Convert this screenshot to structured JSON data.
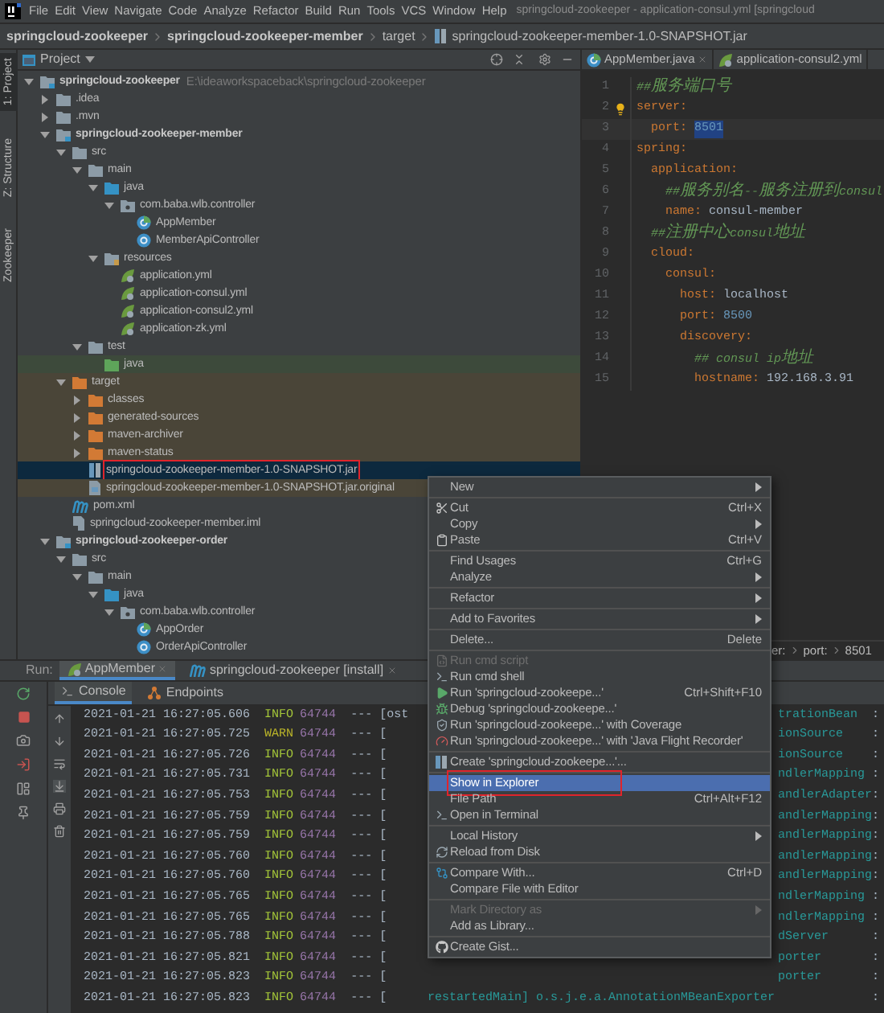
{
  "menu_bar": {
    "items": [
      "File",
      "Edit",
      "View",
      "Navigate",
      "Code",
      "Analyze",
      "Refactor",
      "Build",
      "Run",
      "Tools",
      "VCS",
      "Window",
      "Help"
    ],
    "title": "springcloud-zookeeper - application-consul.yml [springcloud"
  },
  "breadcrumbs": [
    "springcloud-zookeeper",
    "springcloud-zookeeper-member",
    "target",
    "springcloud-zookeeper-member-1.0-SNAPSHOT.jar"
  ],
  "tool_strip": [
    {
      "label": "1: Project",
      "selected": true
    },
    {
      "label": "Z: Structure",
      "selected": false
    },
    {
      "label": "Zookeeper",
      "selected": false
    }
  ],
  "project": {
    "title": "Project",
    "tree": [
      {
        "label": "springcloud-zookeeper",
        "kind": "module",
        "path": "E:\\ideaworkspaceback\\springcloud-zookeeper",
        "expanded": true,
        "selected": false,
        "children": [
          {
            "label": ".idea",
            "kind": "folder",
            "expanded": false,
            "selected": false
          },
          {
            "label": ".mvn",
            "kind": "folder",
            "expanded": false,
            "selected": false
          },
          {
            "label": "springcloud-zookeeper-member",
            "kind": "module",
            "expanded": true,
            "selected": false,
            "children": [
              {
                "label": "src",
                "kind": "folder",
                "expanded": true,
                "selected": false,
                "children": [
                  {
                    "label": "main",
                    "kind": "folder",
                    "expanded": true,
                    "selected": false,
                    "children": [
                      {
                        "label": "java",
                        "kind": "source-folder",
                        "expanded": true,
                        "selected": false,
                        "children": [
                          {
                            "label": "com.baba.wlb.controller",
                            "kind": "package",
                            "expanded": true,
                            "selected": false,
                            "children": [
                              {
                                "label": "AppMember",
                                "kind": "spring-class",
                                "selected": false
                              },
                              {
                                "label": "MemberApiController",
                                "kind": "class",
                                "selected": false
                              }
                            ]
                          }
                        ]
                      },
                      {
                        "label": "resources",
                        "kind": "resources-folder",
                        "expanded": true,
                        "selected": false,
                        "children": [
                          {
                            "label": "application.yml",
                            "kind": "yml",
                            "selected": false
                          },
                          {
                            "label": "application-consul.yml",
                            "kind": "yml",
                            "selected": false
                          },
                          {
                            "label": "application-consul2.yml",
                            "kind": "yml",
                            "selected": false
                          },
                          {
                            "label": "application-zk.yml",
                            "kind": "yml",
                            "selected": false
                          }
                        ]
                      }
                    ]
                  },
                  {
                    "label": "test",
                    "kind": "folder",
                    "expanded": true,
                    "selected": false,
                    "children": [
                      {
                        "label": "java",
                        "kind": "test-folder",
                        "selected": false
                      }
                    ]
                  }
                ]
              },
              {
                "label": "target",
                "kind": "excluded-folder",
                "expanded": true,
                "excluded": true,
                "selected": false,
                "children": [
                  {
                    "label": "classes",
                    "kind": "excluded-folder",
                    "expanded": false,
                    "excluded": true,
                    "selected": false
                  },
                  {
                    "label": "generated-sources",
                    "kind": "excluded-folder",
                    "expanded": false,
                    "excluded": true,
                    "selected": false
                  },
                  {
                    "label": "maven-archiver",
                    "kind": "excluded-folder",
                    "expanded": false,
                    "excluded": true,
                    "selected": false
                  },
                  {
                    "label": "maven-status",
                    "kind": "excluded-folder",
                    "expanded": false,
                    "excluded": true,
                    "selected": false
                  },
                  {
                    "label": "springcloud-zookeeper-member-1.0-SNAPSHOT.jar",
                    "kind": "jar",
                    "selected": true,
                    "outlined": true
                  },
                  {
                    "label": "springcloud-zookeeper-member-1.0-SNAPSHOT.jar.original",
                    "kind": "archive-file",
                    "excluded": true,
                    "selected": false
                  }
                ]
              },
              {
                "label": "pom.xml",
                "kind": "maven",
                "selected": false
              },
              {
                "label": "springcloud-zookeeper-member.iml",
                "kind": "iml",
                "selected": false
              }
            ]
          },
          {
            "label": "springcloud-zookeeper-order",
            "kind": "module",
            "expanded": true,
            "selected": false,
            "children": [
              {
                "label": "src",
                "kind": "folder",
                "expanded": true,
                "selected": false,
                "children": [
                  {
                    "label": "main",
                    "kind": "folder",
                    "expanded": true,
                    "selected": false,
                    "children": [
                      {
                        "label": "java",
                        "kind": "source-folder",
                        "expanded": true,
                        "selected": false,
                        "children": [
                          {
                            "label": "com.baba.wlb.controller",
                            "kind": "package",
                            "expanded": true,
                            "selected": false,
                            "children": [
                              {
                                "label": "AppOrder",
                                "kind": "spring-class",
                                "selected": false
                              },
                              {
                                "label": "OrderApiController",
                                "kind": "class",
                                "selected": false
                              }
                            ]
                          }
                        ]
                      }
                    ]
                  }
                ]
              }
            ]
          }
        ]
      }
    ]
  },
  "editor": {
    "tabs": [
      {
        "label": "AppMember.java",
        "kind": "spring-class"
      },
      {
        "label": "application-consul2.yml",
        "kind": "yml"
      }
    ],
    "lines": [
      {
        "number": "1",
        "tokens": [
          {
            "kind": "comment",
            "text": "##服务端口号"
          }
        ]
      },
      {
        "number": "2",
        "bulb": true,
        "tokens": [
          {
            "kind": "key",
            "text": "server"
          },
          {
            "kind": "punct",
            "text": ":"
          }
        ]
      },
      {
        "number": "3",
        "current": true,
        "tokens": [
          {
            "kind": "key",
            "text": "  port"
          },
          {
            "kind": "punct",
            "text": ": "
          },
          {
            "kind": "selection",
            "text": "8501"
          }
        ]
      },
      {
        "number": "4",
        "tokens": [
          {
            "kind": "key",
            "text": "spring"
          },
          {
            "kind": "punct",
            "text": ":"
          }
        ]
      },
      {
        "number": "5",
        "tokens": [
          {
            "kind": "key",
            "text": "  application"
          },
          {
            "kind": "punct",
            "text": ":"
          }
        ]
      },
      {
        "number": "6",
        "tokens": [
          {
            "kind": "comment",
            "text": "    ##服务别名--服务注册到consul"
          }
        ]
      },
      {
        "number": "7",
        "tokens": [
          {
            "kind": "key",
            "text": "    name"
          },
          {
            "kind": "punct",
            "text": ": "
          },
          {
            "kind": "value",
            "text": "consul-member"
          }
        ]
      },
      {
        "number": "8",
        "tokens": [
          {
            "kind": "comment",
            "text": "  ##注册中心consul地址"
          }
        ]
      },
      {
        "number": "9",
        "tokens": [
          {
            "kind": "key",
            "text": "  cloud"
          },
          {
            "kind": "punct",
            "text": ":"
          }
        ]
      },
      {
        "number": "10",
        "tokens": [
          {
            "kind": "key",
            "text": "    consul"
          },
          {
            "kind": "punct",
            "text": ":"
          }
        ]
      },
      {
        "number": "11",
        "tokens": [
          {
            "kind": "key",
            "text": "      host"
          },
          {
            "kind": "punct",
            "text": ": "
          },
          {
            "kind": "value",
            "text": "localhost"
          }
        ]
      },
      {
        "number": "12",
        "tokens": [
          {
            "kind": "key",
            "text": "      port"
          },
          {
            "kind": "punct",
            "text": ": "
          },
          {
            "kind": "number",
            "text": "8500"
          }
        ]
      },
      {
        "number": "13",
        "tokens": [
          {
            "kind": "key",
            "text": "      discovery"
          },
          {
            "kind": "punct",
            "text": ":"
          }
        ]
      },
      {
        "number": "14",
        "tokens": [
          {
            "kind": "comment",
            "text": "        ## consul ip地址"
          }
        ]
      },
      {
        "number": "15",
        "tokens": [
          {
            "kind": "key",
            "text": "        hostname"
          },
          {
            "kind": "punct",
            "text": ": "
          },
          {
            "kind": "value",
            "text": "192.168.3.91"
          }
        ]
      }
    ],
    "breadcrumbs": [
      "er:",
      "port:",
      "8501"
    ]
  },
  "run_panel": {
    "label": "Run:",
    "tabs": [
      {
        "label": "AppMember",
        "kind": "spring",
        "selected": true
      },
      {
        "label": "springcloud-zookeeper [install]",
        "kind": "maven",
        "selected": false
      }
    ],
    "subtabs": [
      {
        "label": "Console",
        "selected": true
      },
      {
        "label": "Endpoints",
        "selected": false
      }
    ],
    "log": [
      {
        "kind": "info",
        "time": "2021-01-21 16:27:05.606",
        "level": "INFO",
        "pid": "64744",
        "thread": "--- [ost",
        "logger": "trationBean",
        "colon": ":"
      },
      {
        "kind": "warn",
        "time": "2021-01-21 16:27:05.725",
        "level": "WARN",
        "pid": "64744",
        "thread": "--- [",
        "logger": "ionSource",
        "colon": ":"
      },
      {
        "kind": "info",
        "time": "2021-01-21 16:27:05.726",
        "level": "INFO",
        "pid": "64744",
        "thread": "--- [",
        "logger": "ionSource",
        "colon": ":"
      },
      {
        "kind": "info",
        "time": "2021-01-21 16:27:05.731",
        "level": "INFO",
        "pid": "64744",
        "thread": "--- [",
        "logger": "ndlerMapping",
        "colon": ":"
      },
      {
        "kind": "info",
        "time": "2021-01-21 16:27:05.753",
        "level": "INFO",
        "pid": "64744",
        "thread": "--- [",
        "logger": "andlerAdapter",
        "colon": ":"
      },
      {
        "kind": "info",
        "time": "2021-01-21 16:27:05.759",
        "level": "INFO",
        "pid": "64744",
        "thread": "--- [",
        "logger": "andlerMapping",
        "colon": ":"
      },
      {
        "kind": "info",
        "time": "2021-01-21 16:27:05.759",
        "level": "INFO",
        "pid": "64744",
        "thread": "--- [",
        "logger": "andlerMapping",
        "colon": ":"
      },
      {
        "kind": "info",
        "time": "2021-01-21 16:27:05.760",
        "level": "INFO",
        "pid": "64744",
        "thread": "--- [",
        "logger": "andlerMapping",
        "colon": ":"
      },
      {
        "kind": "info",
        "time": "2021-01-21 16:27:05.760",
        "level": "INFO",
        "pid": "64744",
        "thread": "--- [",
        "logger": "andlerMapping",
        "colon": ":"
      },
      {
        "kind": "info",
        "time": "2021-01-21 16:27:05.765",
        "level": "INFO",
        "pid": "64744",
        "thread": "--- [",
        "logger": "ndlerMapping",
        "colon": ":"
      },
      {
        "kind": "info",
        "time": "2021-01-21 16:27:05.765",
        "level": "INFO",
        "pid": "64744",
        "thread": "--- [",
        "logger": "ndlerMapping",
        "colon": ":"
      },
      {
        "kind": "info",
        "time": "2021-01-21 16:27:05.788",
        "level": "INFO",
        "pid": "64744",
        "thread": "--- [",
        "logger": "dServer",
        "colon": ":"
      },
      {
        "kind": "info",
        "time": "2021-01-21 16:27:05.821",
        "level": "INFO",
        "pid": "64744",
        "thread": "--- [",
        "logger": "porter",
        "colon": ":"
      },
      {
        "kind": "info",
        "time": "2021-01-21 16:27:05.823",
        "level": "INFO",
        "pid": "64744",
        "thread": "--- [",
        "logger": "porter",
        "colon": ":"
      },
      {
        "kind": "info",
        "time": "2021-01-21 16:27:05.823",
        "level": "INFO",
        "pid": "64744",
        "thread": "--- [",
        "message": "restartedMain] o.s.j.e.a.AnnotationMBeanExporter",
        "colon": ":"
      }
    ]
  },
  "context_menu": {
    "groups": [
      {
        "items": [
          {
            "label": "New",
            "submenu": true,
            "selected": false,
            "disabled": false
          }
        ]
      },
      {
        "items": [
          {
            "label": "Cut",
            "kind": "cut",
            "shortcut": "Ctrl+X",
            "selected": false,
            "disabled": false
          },
          {
            "label": "Copy",
            "submenu": true,
            "selected": false,
            "disabled": false
          },
          {
            "label": "Paste",
            "kind": "paste",
            "shortcut": "Ctrl+V",
            "selected": false,
            "disabled": false
          }
        ]
      },
      {
        "items": [
          {
            "label": "Find Usages",
            "shortcut": "Ctrl+G",
            "selected": false,
            "disabled": false
          },
          {
            "label": "Analyze",
            "submenu": true,
            "selected": false,
            "disabled": false
          }
        ]
      },
      {
        "items": [
          {
            "label": "Refactor",
            "submenu": true,
            "selected": false,
            "disabled": false
          }
        ]
      },
      {
        "items": [
          {
            "label": "Add to Favorites",
            "submenu": true,
            "selected": false,
            "disabled": false
          }
        ]
      },
      {
        "items": [
          {
            "label": "Delete...",
            "shortcut": "Delete",
            "selected": false,
            "disabled": false
          }
        ]
      },
      {
        "items": [
          {
            "label": "Run cmd script",
            "kind": "script",
            "selected": false,
            "disabled": true
          },
          {
            "label": "Run cmd shell",
            "kind": "shell",
            "selected": false,
            "disabled": false
          },
          {
            "label": "Run 'springcloud-zookeepe...'",
            "kind": "run",
            "shortcut": "Ctrl+Shift+F10",
            "selected": false,
            "disabled": false
          },
          {
            "label": "Debug 'springcloud-zookeepe...'",
            "kind": "debug",
            "selected": false,
            "disabled": false
          },
          {
            "label": "Run 'springcloud-zookeepe...' with Coverage",
            "kind": "coverage",
            "selected": false,
            "disabled": false
          },
          {
            "label": "Run 'springcloud-zookeepe...' with 'Java Flight Recorder'",
            "kind": "profiler",
            "selected": false,
            "disabled": false
          }
        ]
      },
      {
        "items": [
          {
            "label": "Create 'springcloud-zookeepe...'...",
            "kind": "jar",
            "selected": false,
            "disabled": false
          }
        ]
      },
      {
        "items": [
          {
            "label": "Show in Explorer",
            "selected": true,
            "outlined": true,
            "disabled": false
          },
          {
            "label": "File Path",
            "shortcut": "Ctrl+Alt+F12",
            "selected": false,
            "disabled": false
          },
          {
            "label": "Open in Terminal",
            "kind": "terminal",
            "selected": false,
            "disabled": false
          }
        ]
      },
      {
        "items": [
          {
            "label": "Local History",
            "submenu": true,
            "selected": false,
            "disabled": false
          },
          {
            "label": "Reload from Disk",
            "kind": "reload",
            "selected": false,
            "disabled": false
          }
        ]
      },
      {
        "items": [
          {
            "label": "Compare With...",
            "kind": "compare",
            "shortcut": "Ctrl+D",
            "selected": false,
            "disabled": false
          },
          {
            "label": "Compare File with Editor",
            "selected": false,
            "disabled": false
          }
        ]
      },
      {
        "items": [
          {
            "label": "Mark Directory as",
            "submenu": true,
            "selected": false,
            "disabled": true
          },
          {
            "label": "Add as Library...",
            "selected": false,
            "disabled": false
          }
        ]
      },
      {
        "items": [
          {
            "label": "Create Gist...",
            "kind": "github",
            "selected": false,
            "disabled": false
          }
        ]
      }
    ]
  }
}
